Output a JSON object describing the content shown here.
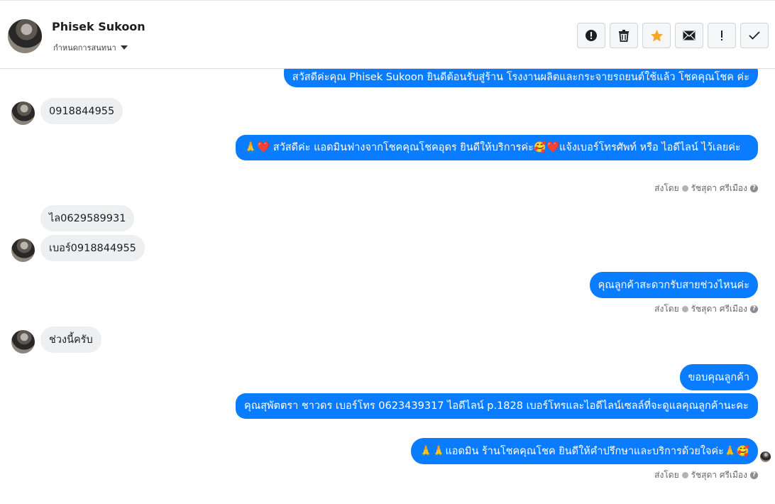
{
  "header": {
    "contact_name": "Phisek Sukoon",
    "label_select": "กำหนดการสนทนา",
    "actions": [
      {
        "icon": "alert-circle-icon"
      },
      {
        "icon": "trash-icon"
      },
      {
        "icon": "star-icon"
      },
      {
        "icon": "mail-icon"
      },
      {
        "icon": "exclamation-icon"
      },
      {
        "icon": "check-icon"
      }
    ]
  },
  "messages": [
    {
      "dir": "out",
      "text": "สวัสดีค่ะคุณ Phisek Sukoon ยินดีต้อนรับสู่ร้าน โรงงานผลิตและกระจายรถยนต์ใช้แล้ว โชคคุณโชค ค่ะ"
    },
    {
      "dir": "in",
      "text": "0918844955"
    },
    {
      "dir": "out",
      "text": "🙏❤️ สวัสดีค่ะ แอดมินฟางจากโชคคุณโชคอุดร ยินดีให้บริการค่ะ🥰❤️แจ้งเบอร์โทรศัพท์ หรือ ไอดีไลน์  ไว้เลยค่ะ"
    },
    {
      "dir": "in",
      "text": "ไล0629589931"
    },
    {
      "dir": "in",
      "text": "เบอร์0918844955"
    },
    {
      "dir": "out",
      "text": "คุณลูกค้าสะดวกรับสายช่วงไหนค่ะ"
    },
    {
      "dir": "in",
      "text": "ช่วงนี้ครับ"
    },
    {
      "dir": "out",
      "text": "ขอบคุณลูกค้า"
    },
    {
      "dir": "out",
      "text": "คุณสุพัตตรา   ชาวดร     เบอร์โทร 0623439317  ไอดีไลน์ p.1828  เบอร์โทรและไอดีไลน์เซลล์ที่จะดูแลคุณลูกค้านะคะ"
    },
    {
      "dir": "out",
      "text": "🙏🙏แอดมิน ร้านโชคคุณโชค ยินดีให้คำปรึกษาและบริการด้วยใจค่ะ🙏🥰"
    }
  ],
  "sent_by": {
    "prefix": "ส่งโดย",
    "name": "รัชสุดา ศรีเมือง",
    "help": "?"
  },
  "colors": {
    "outgoing": "#0a7cff",
    "incoming": "#eeeff1",
    "star": "#f5a623"
  }
}
